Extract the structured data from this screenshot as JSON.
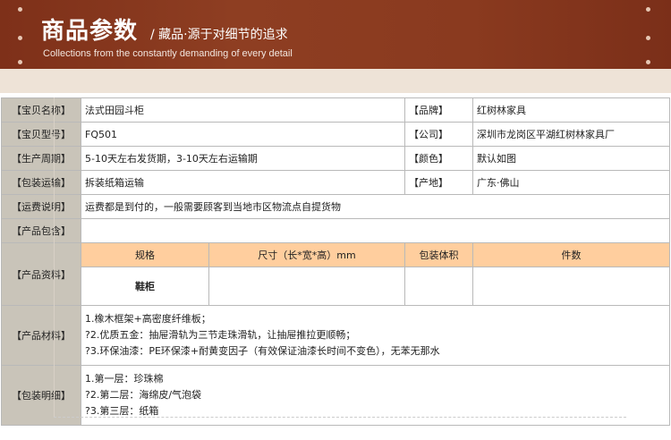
{
  "header": {
    "title": "商品参数",
    "subtitle": "/ 藏品·源于对细节的追求",
    "english": "Collections from the constantly demanding of every detail"
  },
  "labels": {
    "name": "【宝贝名称】",
    "brand": "【品牌】",
    "model": "【宝贝型号】",
    "company": "【公司】",
    "cycle": "【生产周期】",
    "color": "【颜色】",
    "pack_ship": "【包装运输】",
    "origin": "【产地】",
    "freight": "【运费说明】",
    "includes": "【产品包含】",
    "data": "【产品资料】",
    "material": "【产品材料】",
    "pack_detail": "【包装明细】"
  },
  "values": {
    "name": "法式田园斗柜",
    "brand": "红树林家具",
    "model": "FQ501",
    "company": "深圳市龙岗区平湖红树林家具厂",
    "cycle": "5-10天左右发货期，3-10天左右运输期",
    "color": "默认如图",
    "pack_ship": "拆装纸箱运输",
    "origin": "广东·佛山",
    "freight": "运费都是到付的，一般需要顾客到当地市区物流点自提货物",
    "includes": ""
  },
  "data_table": {
    "headers": [
      "规格",
      "尺寸（长*宽*高）mm",
      "包装体积",
      "件数"
    ],
    "row": [
      "鞋柜",
      "",
      "",
      ""
    ]
  },
  "material_lines": [
    " 1.橡木框架+高密度纤维板；",
    "?2.优质五金：抽屉滑轨为三节走珠滑轨，让抽屉推拉更顺畅；",
    "?3.环保油漆：PE环保漆+耐黄变因子（有效保证油漆长时间不变色），无苯无那水"
  ],
  "pack_lines": [
    " 1.第一层：珍珠棉",
    "?2.第二层：海绵皮/气泡袋",
    "?3.第三层：纸箱"
  ],
  "colors": {
    "banner": "#8b3a20",
    "label_bg": "#c9c4b9",
    "inner_header_bg": "#ffce9e"
  }
}
